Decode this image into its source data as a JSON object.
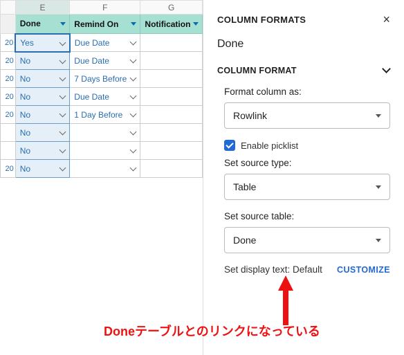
{
  "columns": {
    "E": {
      "letter": "E",
      "header": "Done"
    },
    "F": {
      "letter": "F",
      "header": "Remind On"
    },
    "G": {
      "letter": "G",
      "header": "Notification"
    }
  },
  "rows": [
    {
      "num": "20",
      "done": "Yes",
      "remind": "Due Date"
    },
    {
      "num": "20",
      "done": "No",
      "remind": "Due Date"
    },
    {
      "num": "20",
      "done": "No",
      "remind": "7 Days Before"
    },
    {
      "num": "20",
      "done": "No",
      "remind": "Due Date"
    },
    {
      "num": "20",
      "done": "No",
      "remind": "1 Day Before"
    },
    {
      "num": "",
      "done": "No",
      "remind": ""
    },
    {
      "num": "",
      "done": "No",
      "remind": ""
    },
    {
      "num": "20",
      "done": "No",
      "remind": ""
    }
  ],
  "panel": {
    "title": "COLUMN FORMATS",
    "fieldName": "Done",
    "section": "COLUMN FORMAT",
    "formatAsLabel": "Format column as:",
    "formatAs": "Rowlink",
    "enablePicklist": "Enable picklist",
    "sourceTypeLabel": "Set source type:",
    "sourceType": "Table",
    "sourceTableLabel": "Set source table:",
    "sourceTable": "Done",
    "displayTextLabel": "Set display text: Default",
    "customize": "CUSTOMIZE"
  },
  "annotation": "Doneテーブルとのリンクになっている"
}
